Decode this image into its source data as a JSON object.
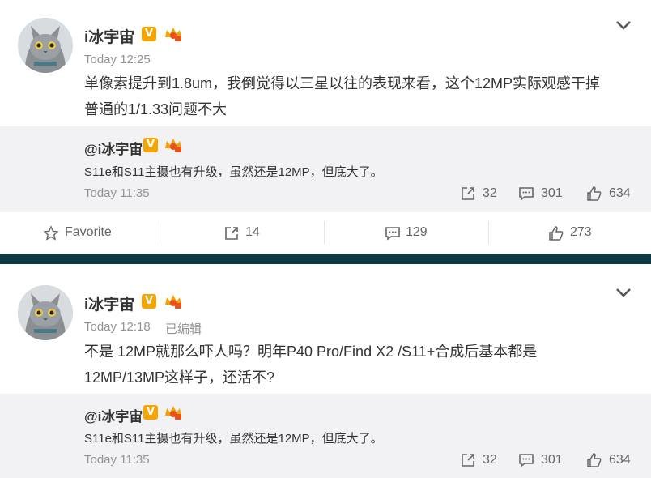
{
  "colors": {
    "divider": "#0d3a42",
    "repost_bg": "#f2f2f5",
    "verified_badge": "#f7a400",
    "timestamp": "#939393"
  },
  "posts": [
    {
      "avatar_icon": "cat-avatar",
      "user": "i冰宇宙",
      "verified_icon": "verified-v-icon",
      "vip_icon": "vip-crown-icon",
      "timestamp": "Today 12:25",
      "edited_label": "",
      "text_line1": "单像素提升到1.8um，我倒觉得以三星以往的表现来看，这个12MP实际观感干掉",
      "text_line2": "普通的1/1.33问题不大",
      "repost": {
        "user": "@i冰宇宙",
        "text": "S11e和S11主摄也有升级，虽然还是12MP，但底大了。",
        "timestamp": "Today 11:35",
        "reposts": "32",
        "comments": "301",
        "likes": "634"
      }
    },
    {
      "avatar_icon": "cat-avatar",
      "user": "i冰宇宙",
      "verified_icon": "verified-v-icon",
      "vip_icon": "vip-crown-icon",
      "timestamp": "Today 12:18",
      "edited_label": "已编辑",
      "text_line1": "不是 12MP就那么吓人吗？明年P40 Pro/Find X2 /S11+合成后基本都是",
      "text_line2": "12MP/13MP这样子，还活不?",
      "repost": {
        "user": "@i冰宇宙",
        "text": "S11e和S11主摄也有升级，虽然还是12MP，但底大了。",
        "timestamp": "Today 11:35",
        "reposts": "32",
        "comments": "301",
        "likes": "634"
      }
    }
  ],
  "actions": {
    "favorite": "Favorite",
    "reposts": "14",
    "comments": "129",
    "likes": "273"
  }
}
